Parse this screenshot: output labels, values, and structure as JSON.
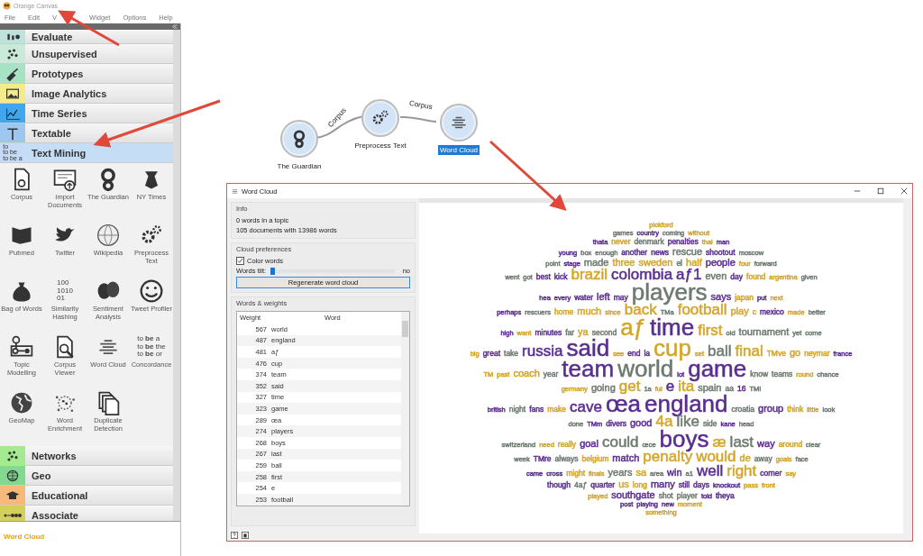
{
  "app": {
    "title": "Orange Canvas",
    "menu": [
      "File",
      "Edit",
      "V",
      "Widget",
      "Options",
      "Help"
    ]
  },
  "toolbox": {
    "categories": [
      {
        "label": "Evaluate",
        "kind": "bars",
        "color": "#bfe3dc",
        "expanded": false
      },
      {
        "label": "Unsupervised",
        "kind": "cluster",
        "color": "#c9ead9",
        "expanded": false
      },
      {
        "label": "Prototypes",
        "kind": "shovel",
        "color": "#a8e2c4",
        "expanded": false
      },
      {
        "label": "Image Analytics",
        "kind": "image",
        "color": "#f4eb8c",
        "expanded": false
      },
      {
        "label": "Time Series",
        "kind": "line",
        "color": "#3ea7ee",
        "expanded": false
      },
      {
        "label": "Textable",
        "kind": "beam",
        "color": "#9fc6ee",
        "expanded": false
      },
      {
        "label": "Text Mining",
        "kind": "text",
        "color": "#c6dcf6",
        "expanded": true,
        "icon_text": [
          "to",
          "to be",
          "to be a"
        ],
        "widgets": [
          {
            "label": "Corpus",
            "kind": "corpus"
          },
          {
            "label": "Import Documents",
            "kind": "import"
          },
          {
            "label": "The Guardian",
            "kind": "guardian"
          },
          {
            "label": "NY Times",
            "kind": "nytimes"
          },
          {
            "label": "Pubmed",
            "kind": "pubmed"
          },
          {
            "label": "Twitter",
            "kind": "twitter"
          },
          {
            "label": "Wikipedia",
            "kind": "wikipedia"
          },
          {
            "label": "Preprocess Text",
            "kind": "preprocess"
          },
          {
            "label": "Bag of Words",
            "kind": "bag"
          },
          {
            "label": "Similarity Hashing",
            "kind": "text",
            "icon_text": [
              "100",
              "1010",
              "01"
            ]
          },
          {
            "label": "Sentiment Analysis",
            "kind": "masks"
          },
          {
            "label": "Tweet Profiler",
            "kind": "smiley"
          },
          {
            "label": "Topic Modelling",
            "kind": "topic"
          },
          {
            "label": "Corpus Viewer",
            "kind": "viewer"
          },
          {
            "label": "Word Cloud",
            "kind": "wordcloud"
          },
          {
            "label": "Concordance",
            "kind": "text",
            "icon_text": [
              "to **be** a",
              "to **be** the",
              "to **be** or"
            ]
          },
          {
            "label": "GeoMap",
            "kind": "globe"
          },
          {
            "label": "Word Enrichment",
            "kind": "enrich"
          },
          {
            "label": "Duplicate Detection",
            "kind": "duplicate"
          }
        ]
      },
      {
        "label": "Networks",
        "kind": "cluster",
        "color": "#a6ea8f",
        "expanded": false
      },
      {
        "label": "Geo",
        "kind": "globe",
        "color": "#82d98f",
        "expanded": false
      },
      {
        "label": "Educational",
        "kind": "cap",
        "color": "#f6b97a",
        "expanded": false
      },
      {
        "label": "Associate",
        "kind": "dotline",
        "color": "#d3cf5b",
        "expanded": false
      }
    ],
    "help_title": "Word Cloud"
  },
  "canvas": {
    "nodes": [
      {
        "label": "The Guardian",
        "kind": "guardian",
        "selected": false
      },
      {
        "label": "Preprocess Text",
        "kind": "preprocess",
        "selected": false
      },
      {
        "label": "Word Cloud",
        "kind": "wordcloud",
        "selected": true
      }
    ],
    "links": [
      {
        "label": "Corpus"
      },
      {
        "label": "Corpus"
      }
    ]
  },
  "dialog": {
    "title": "Word Cloud",
    "info": {
      "title": "Info",
      "lines": [
        "0 words in a topic",
        "105 documents with 13986 words"
      ]
    },
    "preferences": {
      "title": "Cloud preferences",
      "color_words": {
        "label": "Color words",
        "checked": true
      },
      "tilt": {
        "label": "Words tilt:",
        "level": 0.0,
        "reading": "no"
      },
      "button": "Regenerate word cloud"
    },
    "weights": {
      "title": "Words & weights",
      "columns": [
        "Weight",
        "Word"
      ],
      "rows": [
        {
          "weight": "567",
          "word": "world"
        },
        {
          "weight": "487",
          "word": "england"
        },
        {
          "weight": "481",
          "word": "aƒ"
        },
        {
          "weight": "476",
          "word": "cup"
        },
        {
          "weight": "374",
          "word": "team"
        },
        {
          "weight": "352",
          "word": "said"
        },
        {
          "weight": "327",
          "word": "time"
        },
        {
          "weight": "323",
          "word": "game"
        },
        {
          "weight": "289",
          "word": "œa"
        },
        {
          "weight": "274",
          "word": "players"
        },
        {
          "weight": "268",
          "word": "boys"
        },
        {
          "weight": "267",
          "word": "last"
        },
        {
          "weight": "259",
          "word": "ball"
        },
        {
          "weight": "258",
          "word": "first"
        },
        {
          "weight": "254",
          "word": "e"
        },
        {
          "weight": "253",
          "word": "football"
        }
      ]
    },
    "cloud": [
      [
        {
          "text": "pickford",
          "color": "#d4a52a",
          "kind": "tiny"
        }
      ],
      [
        {
          "text": "games",
          "color": "#6e7a70",
          "kind": "tiny"
        },
        {
          "text": "country",
          "color": "#5a2d91",
          "kind": "tiny"
        },
        {
          "text": "coming",
          "color": "#6e7a70",
          "kind": "tiny"
        },
        {
          "text": "without",
          "color": "#d4a52a",
          "kind": "tiny"
        }
      ],
      [
        {
          "text": "thata",
          "color": "#5a2d91",
          "kind": "tiny"
        },
        {
          "text": "never",
          "color": "#d4a52a",
          "kind": "small"
        },
        {
          "text": "denmark",
          "color": "#6e7a70",
          "kind": "small"
        },
        {
          "text": "penalties",
          "color": "#5a2d91",
          "kind": "small"
        },
        {
          "text": "thai",
          "color": "#d4a52a",
          "kind": "tiny"
        },
        {
          "text": "man",
          "color": "#5a2d91",
          "kind": "tiny"
        }
      ],
      [
        {
          "text": "young",
          "color": "#5a2d91",
          "kind": "tiny"
        },
        {
          "text": "box",
          "color": "#6e7a70",
          "kind": "tiny"
        },
        {
          "text": "enough",
          "color": "#6e7a70",
          "kind": "tiny"
        },
        {
          "text": "another",
          "color": "#5a2d91",
          "kind": "small"
        },
        {
          "text": "news",
          "color": "#5a2d91",
          "kind": "small"
        },
        {
          "text": "rescue",
          "color": "#6e7a70",
          "kind": "mid"
        },
        {
          "text": "shootout",
          "color": "#5a2d91",
          "kind": "small"
        },
        {
          "text": "moscow",
          "color": "#6e7a70",
          "kind": "tiny"
        }
      ],
      [
        {
          "text": "point",
          "color": "#6e7a70",
          "kind": "tiny"
        },
        {
          "text": "stage",
          "color": "#5a2d91",
          "kind": "tiny"
        },
        {
          "text": "made",
          "color": "#6e7a70",
          "kind": "mid"
        },
        {
          "text": "three",
          "color": "#d4a52a",
          "kind": "mid"
        },
        {
          "text": "sweden",
          "color": "#d4a52a",
          "kind": "mid"
        },
        {
          "text": "el",
          "color": "#6e7a70",
          "kind": "small"
        },
        {
          "text": "half",
          "color": "#d4a52a",
          "kind": "mid"
        },
        {
          "text": "people",
          "color": "#5a2d91",
          "kind": "mid"
        },
        {
          "text": "four",
          "color": "#d4a52a",
          "kind": "tiny"
        },
        {
          "text": "forward",
          "color": "#6e7a70",
          "kind": "tiny"
        }
      ],
      [
        {
          "text": "went",
          "color": "#6e7a70",
          "kind": "tiny"
        },
        {
          "text": "got",
          "color": "#6e7a70",
          "kind": "tiny"
        },
        {
          "text": "best",
          "color": "#5a2d91",
          "kind": "small"
        },
        {
          "text": "kick",
          "color": "#5a2d91",
          "kind": "small"
        },
        {
          "text": "brazil",
          "color": "#d4a52a",
          "kind": "big"
        },
        {
          "text": "colombia",
          "color": "#5a2d91",
          "kind": "big"
        },
        {
          "text": "aƒ1",
          "color": "#5a2d91",
          "kind": "big"
        },
        {
          "text": "even",
          "color": "#6e7a70",
          "kind": "mid"
        },
        {
          "text": "day",
          "color": "#5a2d91",
          "kind": "small"
        },
        {
          "text": "found",
          "color": "#d4a52a",
          "kind": "small"
        },
        {
          "text": "argentina",
          "color": "#d4a52a",
          "kind": "tiny"
        },
        {
          "text": "given",
          "color": "#6e7a70",
          "kind": "tiny"
        }
      ],
      [
        {
          "text": "hea",
          "color": "#5a2d91",
          "kind": "tiny"
        },
        {
          "text": "every",
          "color": "#5a2d91",
          "kind": "tiny"
        },
        {
          "text": "water",
          "color": "#5a2d91",
          "kind": "small"
        },
        {
          "text": "left",
          "color": "#5a2d91",
          "kind": "mid"
        },
        {
          "text": "may",
          "color": "#5a2d91",
          "kind": "small"
        },
        {
          "text": "players",
          "color": "#6e7a70",
          "kind": "huge"
        },
        {
          "text": "says",
          "color": "#5a2d91",
          "kind": "mid"
        },
        {
          "text": "japan",
          "color": "#d4a52a",
          "kind": "small"
        },
        {
          "text": "put",
          "color": "#5a2d91",
          "kind": "tiny"
        },
        {
          "text": "next",
          "color": "#d4a52a",
          "kind": "tiny"
        }
      ],
      [
        {
          "text": "perhaps",
          "color": "#5a2d91",
          "kind": "tiny"
        },
        {
          "text": "rescuers",
          "color": "#6e7a70",
          "kind": "tiny"
        },
        {
          "text": "home",
          "color": "#d4a52a",
          "kind": "small"
        },
        {
          "text": "much",
          "color": "#d4a52a",
          "kind": "mid"
        },
        {
          "text": "since",
          "color": "#d4a52a",
          "kind": "tiny"
        },
        {
          "text": "back",
          "color": "#d4a52a",
          "kind": "big"
        },
        {
          "text": "TMa",
          "color": "#6e7a70",
          "kind": "tiny"
        },
        {
          "text": "football",
          "color": "#d4a52a",
          "kind": "big"
        },
        {
          "text": "play",
          "color": "#d4a52a",
          "kind": "mid"
        },
        {
          "text": "c",
          "color": "#d4a52a",
          "kind": "small"
        },
        {
          "text": "mexico",
          "color": "#5a2d91",
          "kind": "small"
        },
        {
          "text": "made",
          "color": "#d4a52a",
          "kind": "tiny"
        },
        {
          "text": "better",
          "color": "#6e7a70",
          "kind": "tiny"
        }
      ],
      [
        {
          "text": "high",
          "color": "#5a2d91",
          "kind": "tiny"
        },
        {
          "text": "want",
          "color": "#d4a52a",
          "kind": "tiny"
        },
        {
          "text": "minutes",
          "color": "#5a2d91",
          "kind": "small"
        },
        {
          "text": "far",
          "color": "#6e7a70",
          "kind": "small"
        },
        {
          "text": "ya",
          "color": "#d4a52a",
          "kind": "mid"
        },
        {
          "text": "second",
          "color": "#6e7a70",
          "kind": "small"
        },
        {
          "text": "aƒ",
          "color": "#d4a52a",
          "kind": "huge"
        },
        {
          "text": "time",
          "color": "#5a2d91",
          "kind": "huge"
        },
        {
          "text": "first",
          "color": "#d4a52a",
          "kind": "big"
        },
        {
          "text": "old",
          "color": "#6e7a70",
          "kind": "tiny"
        },
        {
          "text": "tournament",
          "color": "#6e7a70",
          "kind": "mid"
        },
        {
          "text": "yet",
          "color": "#6e7a70",
          "kind": "tiny"
        },
        {
          "text": "come",
          "color": "#6e7a70",
          "kind": "tiny"
        }
      ],
      [
        {
          "text": "big",
          "color": "#d4a52a",
          "kind": "tiny"
        },
        {
          "text": "great",
          "color": "#5a2d91",
          "kind": "small"
        },
        {
          "text": "take",
          "color": "#6e7a70",
          "kind": "small"
        },
        {
          "text": "russia",
          "color": "#5a2d91",
          "kind": "big"
        },
        {
          "text": "said",
          "color": "#5a2d91",
          "kind": "huge"
        },
        {
          "text": "see",
          "color": "#d4a52a",
          "kind": "tiny"
        },
        {
          "text": "end",
          "color": "#5a2d91",
          "kind": "small"
        },
        {
          "text": "la",
          "color": "#5a2d91",
          "kind": "small"
        },
        {
          "text": "cup",
          "color": "#d4a52a",
          "kind": "huge"
        },
        {
          "text": "set",
          "color": "#d4a52a",
          "kind": "tiny"
        },
        {
          "text": "ball",
          "color": "#6e7a70",
          "kind": "big"
        },
        {
          "text": "final",
          "color": "#d4a52a",
          "kind": "big"
        },
        {
          "text": "TMve",
          "color": "#d4a52a",
          "kind": "small"
        },
        {
          "text": "go",
          "color": "#d4a52a",
          "kind": "mid"
        },
        {
          "text": "neymar",
          "color": "#d4a52a",
          "kind": "small"
        },
        {
          "text": "france",
          "color": "#5a2d91",
          "kind": "tiny"
        }
      ],
      [
        {
          "text": "TM",
          "color": "#d4a52a",
          "kind": "tiny"
        },
        {
          "text": "past",
          "color": "#d4a52a",
          "kind": "tiny"
        },
        {
          "text": "coach",
          "color": "#d4a52a",
          "kind": "mid"
        },
        {
          "text": "year",
          "color": "#6e7a70",
          "kind": "small"
        },
        {
          "text": "team",
          "color": "#5a2d91",
          "kind": "huge"
        },
        {
          "text": "world",
          "color": "#6e7a70",
          "kind": "huge"
        },
        {
          "text": "lot",
          "color": "#5a2d91",
          "kind": "tiny"
        },
        {
          "text": "game",
          "color": "#5a2d91",
          "kind": "huge"
        },
        {
          "text": "know",
          "color": "#6e7a70",
          "kind": "small"
        },
        {
          "text": "teams",
          "color": "#6e7a70",
          "kind": "small"
        },
        {
          "text": "round",
          "color": "#d4a52a",
          "kind": "tiny"
        },
        {
          "text": "chance",
          "color": "#6e7a70",
          "kind": "tiny"
        }
      ],
      [
        {
          "text": "germany",
          "color": "#d4a52a",
          "kind": "tiny"
        },
        {
          "text": "going",
          "color": "#6e7a70",
          "kind": "mid"
        },
        {
          "text": "get",
          "color": "#d4a52a",
          "kind": "big"
        },
        {
          "text": "1a",
          "color": "#6e7a70",
          "kind": "tiny"
        },
        {
          "text": "ful",
          "color": "#d4a52a",
          "kind": "tiny"
        },
        {
          "text": "e",
          "color": "#5a2d91",
          "kind": "big"
        },
        {
          "text": "ita",
          "color": "#d4a52a",
          "kind": "big"
        },
        {
          "text": "spain",
          "color": "#6e7a70",
          "kind": "mid"
        },
        {
          "text": "aa",
          "color": "#6e7a70",
          "kind": "small"
        },
        {
          "text": "16",
          "color": "#5a2d91",
          "kind": "small"
        },
        {
          "text": "TMI",
          "color": "#6e7a70",
          "kind": "tiny"
        }
      ],
      [
        {
          "text": "british",
          "color": "#5a2d91",
          "kind": "tiny"
        },
        {
          "text": "night",
          "color": "#6e7a70",
          "kind": "small"
        },
        {
          "text": "fans",
          "color": "#5a2d91",
          "kind": "small"
        },
        {
          "text": "make",
          "color": "#d4a52a",
          "kind": "small"
        },
        {
          "text": "cave",
          "color": "#5a2d91",
          "kind": "big"
        },
        {
          "text": "œa",
          "color": "#5a2d91",
          "kind": "huge"
        },
        {
          "text": "england",
          "color": "#5a2d91",
          "kind": "huge"
        },
        {
          "text": "croatia",
          "color": "#6e7a70",
          "kind": "small"
        },
        {
          "text": "group",
          "color": "#5a2d91",
          "kind": "mid"
        },
        {
          "text": "think",
          "color": "#d4a52a",
          "kind": "small"
        },
        {
          "text": "little",
          "color": "#d4a52a",
          "kind": "tiny"
        },
        {
          "text": "look",
          "color": "#6e7a70",
          "kind": "tiny"
        }
      ],
      [
        {
          "text": "done",
          "color": "#6e7a70",
          "kind": "tiny"
        },
        {
          "text": "TMm",
          "color": "#5a2d91",
          "kind": "tiny"
        },
        {
          "text": "divers",
          "color": "#5a2d91",
          "kind": "small"
        },
        {
          "text": "good",
          "color": "#5a2d91",
          "kind": "mid"
        },
        {
          "text": "4a",
          "color": "#d4a52a",
          "kind": "big"
        },
        {
          "text": "like",
          "color": "#6e7a70",
          "kind": "big"
        },
        {
          "text": "side",
          "color": "#6e7a70",
          "kind": "small"
        },
        {
          "text": "kane",
          "color": "#5a2d91",
          "kind": "tiny"
        },
        {
          "text": "head",
          "color": "#6e7a70",
          "kind": "tiny"
        }
      ],
      [
        {
          "text": "switzerland",
          "color": "#6e7a70",
          "kind": "tiny"
        },
        {
          "text": "need",
          "color": "#d4a52a",
          "kind": "tiny"
        },
        {
          "text": "really",
          "color": "#d4a52a",
          "kind": "small"
        },
        {
          "text": "goal",
          "color": "#5a2d91",
          "kind": "mid"
        },
        {
          "text": "could",
          "color": "#6e7a70",
          "kind": "big"
        },
        {
          "text": "œce",
          "color": "#6e7a70",
          "kind": "tiny"
        },
        {
          "text": "boys",
          "color": "#5a2d91",
          "kind": "huge"
        },
        {
          "text": "æ",
          "color": "#d4a52a",
          "kind": "big"
        },
        {
          "text": "last",
          "color": "#6e7a70",
          "kind": "big"
        },
        {
          "text": "way",
          "color": "#5a2d91",
          "kind": "mid"
        },
        {
          "text": "around",
          "color": "#d4a52a",
          "kind": "small"
        },
        {
          "text": "clear",
          "color": "#6e7a70",
          "kind": "tiny"
        }
      ],
      [
        {
          "text": "week",
          "color": "#6e7a70",
          "kind": "tiny"
        },
        {
          "text": "TMre",
          "color": "#5a2d91",
          "kind": "small"
        },
        {
          "text": "always",
          "color": "#6e7a70",
          "kind": "small"
        },
        {
          "text": "belgium",
          "color": "#d4a52a",
          "kind": "small"
        },
        {
          "text": "match",
          "color": "#5a2d91",
          "kind": "mid"
        },
        {
          "text": "penalty",
          "color": "#d4a52a",
          "kind": "big"
        },
        {
          "text": "would",
          "color": "#d4a52a",
          "kind": "big"
        },
        {
          "text": "de",
          "color": "#d4a52a",
          "kind": "mid"
        },
        {
          "text": "away",
          "color": "#6e7a70",
          "kind": "small"
        },
        {
          "text": "goals",
          "color": "#d4a52a",
          "kind": "tiny"
        },
        {
          "text": "face",
          "color": "#6e7a70",
          "kind": "tiny"
        }
      ],
      [
        {
          "text": "came",
          "color": "#5a2d91",
          "kind": "tiny"
        },
        {
          "text": "cross",
          "color": "#5a2d91",
          "kind": "tiny"
        },
        {
          "text": "might",
          "color": "#d4a52a",
          "kind": "small"
        },
        {
          "text": "finals",
          "color": "#d4a52a",
          "kind": "tiny"
        },
        {
          "text": "years",
          "color": "#6e7a70",
          "kind": "mid"
        },
        {
          "text": "sa",
          "color": "#d4a52a",
          "kind": "mid"
        },
        {
          "text": "area",
          "color": "#6e7a70",
          "kind": "tiny"
        },
        {
          "text": "win",
          "color": "#5a2d91",
          "kind": "mid"
        },
        {
          "text": "a1",
          "color": "#6e7a70",
          "kind": "tiny"
        },
        {
          "text": "well",
          "color": "#5a2d91",
          "kind": "big"
        },
        {
          "text": "right",
          "color": "#d4a52a",
          "kind": "big"
        },
        {
          "text": "corner",
          "color": "#5a2d91",
          "kind": "small"
        },
        {
          "text": "say",
          "color": "#d4a52a",
          "kind": "tiny"
        }
      ],
      [
        {
          "text": "though",
          "color": "#5a2d91",
          "kind": "small"
        },
        {
          "text": "4aƒ",
          "color": "#6e7a70",
          "kind": "small"
        },
        {
          "text": "quarter",
          "color": "#5a2d91",
          "kind": "small"
        },
        {
          "text": "us",
          "color": "#d4a52a",
          "kind": "mid"
        },
        {
          "text": "long",
          "color": "#d4a52a",
          "kind": "small"
        },
        {
          "text": "many",
          "color": "#5a2d91",
          "kind": "mid"
        },
        {
          "text": "still",
          "color": "#5a2d91",
          "kind": "small"
        },
        {
          "text": "days",
          "color": "#5a2d91",
          "kind": "small"
        },
        {
          "text": "knockout",
          "color": "#5a2d91",
          "kind": "tiny"
        },
        {
          "text": "pass",
          "color": "#d4a52a",
          "kind": "tiny"
        },
        {
          "text": "front",
          "color": "#d4a52a",
          "kind": "tiny"
        }
      ],
      [
        {
          "text": "played",
          "color": "#d4a52a",
          "kind": "tiny"
        },
        {
          "text": "southgate",
          "color": "#5a2d91",
          "kind": "mid"
        },
        {
          "text": "shot",
          "color": "#6e7a70",
          "kind": "small"
        },
        {
          "text": "player",
          "color": "#6e7a70",
          "kind": "small"
        },
        {
          "text": "told",
          "color": "#5a2d91",
          "kind": "tiny"
        },
        {
          "text": "theya",
          "color": "#5a2d91",
          "kind": "small"
        }
      ],
      [
        {
          "text": "post",
          "color": "#5a2d91",
          "kind": "tiny"
        },
        {
          "text": "playing",
          "color": "#5a2d91",
          "kind": "tiny"
        },
        {
          "text": "new",
          "color": "#5a2d91",
          "kind": "tiny"
        },
        {
          "text": "moment",
          "color": "#d4a52a",
          "kind": "tiny"
        }
      ],
      [
        {
          "text": "something",
          "color": "#d4a52a",
          "kind": "tiny"
        }
      ]
    ]
  }
}
